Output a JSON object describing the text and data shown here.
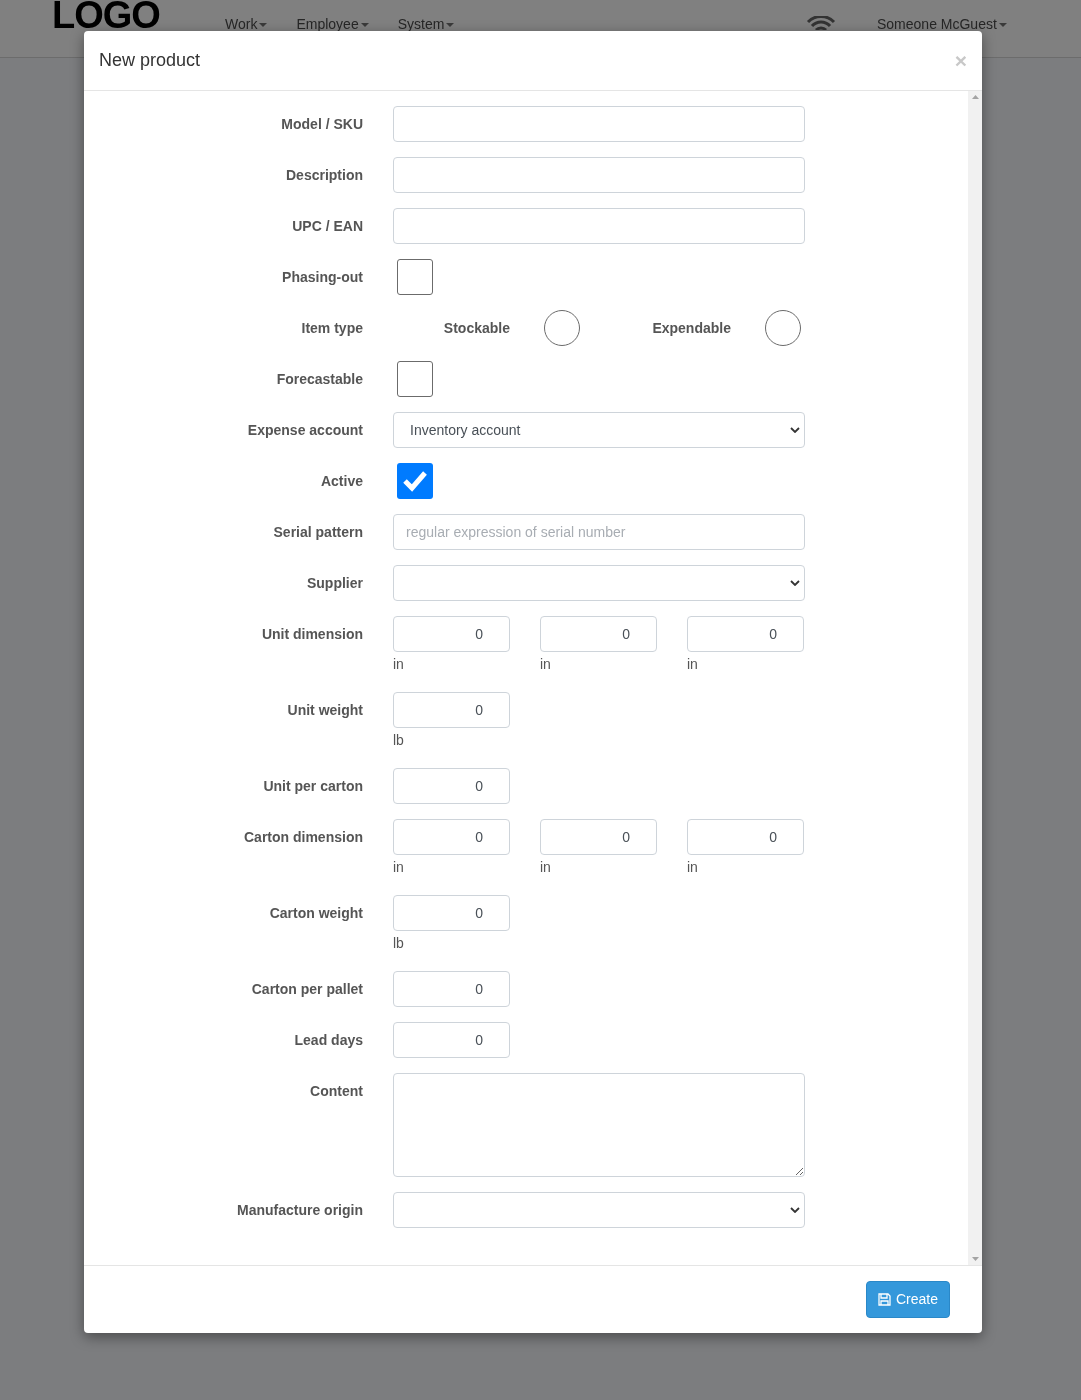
{
  "navbar": {
    "logo": "LOGO",
    "menus": [
      {
        "label": "Work"
      },
      {
        "label": "Employee"
      },
      {
        "label": "System"
      }
    ],
    "user": "Someone McGuest"
  },
  "modal": {
    "title": "New product",
    "close": "×",
    "fields": [
      {
        "kind": "text",
        "label": "Model / SKU"
      },
      {
        "kind": "text",
        "label": "Description"
      },
      {
        "kind": "text",
        "label": "UPC / EAN"
      },
      {
        "kind": "checkbox",
        "label": "Phasing-out",
        "checked": false
      },
      {
        "kind": "radio",
        "label": "Item type",
        "options": [
          {
            "label": "Stockable",
            "selected": false
          },
          {
            "label": "Expendable",
            "selected": false
          }
        ]
      },
      {
        "kind": "checkbox",
        "label": "Forecastable",
        "checked": false
      },
      {
        "kind": "select",
        "label": "Expense account",
        "value": "Inventory account"
      },
      {
        "kind": "checkbox",
        "label": "Active",
        "checked": true
      },
      {
        "kind": "text",
        "label": "Serial pattern",
        "placeholder": "regular expression of serial number"
      },
      {
        "kind": "select",
        "label": "Supplier"
      },
      {
        "kind": "numbers",
        "label": "Unit dimension",
        "inputs": [
          {
            "value": "0",
            "unit": "in"
          },
          {
            "value": "0",
            "unit": "in"
          },
          {
            "value": "0",
            "unit": "in"
          }
        ]
      },
      {
        "kind": "numbers",
        "label": "Unit weight",
        "inputs": [
          {
            "value": "0",
            "unit": "lb"
          }
        ]
      },
      {
        "kind": "numbers",
        "label": "Unit per carton",
        "inputs": [
          {
            "value": "0"
          }
        ]
      },
      {
        "kind": "numbers",
        "label": "Carton dimension",
        "inputs": [
          {
            "value": "0",
            "unit": "in"
          },
          {
            "value": "0",
            "unit": "in"
          },
          {
            "value": "0",
            "unit": "in"
          }
        ]
      },
      {
        "kind": "numbers",
        "label": "Carton weight",
        "inputs": [
          {
            "value": "0",
            "unit": "lb"
          }
        ]
      },
      {
        "kind": "numbers",
        "label": "Carton per pallet",
        "inputs": [
          {
            "value": "0"
          }
        ]
      },
      {
        "kind": "numbers",
        "label": "Lead days",
        "inputs": [
          {
            "value": "0"
          }
        ]
      },
      {
        "kind": "textarea",
        "label": "Content"
      },
      {
        "kind": "select",
        "label": "Manufacture origin"
      }
    ],
    "submit": "Create"
  }
}
